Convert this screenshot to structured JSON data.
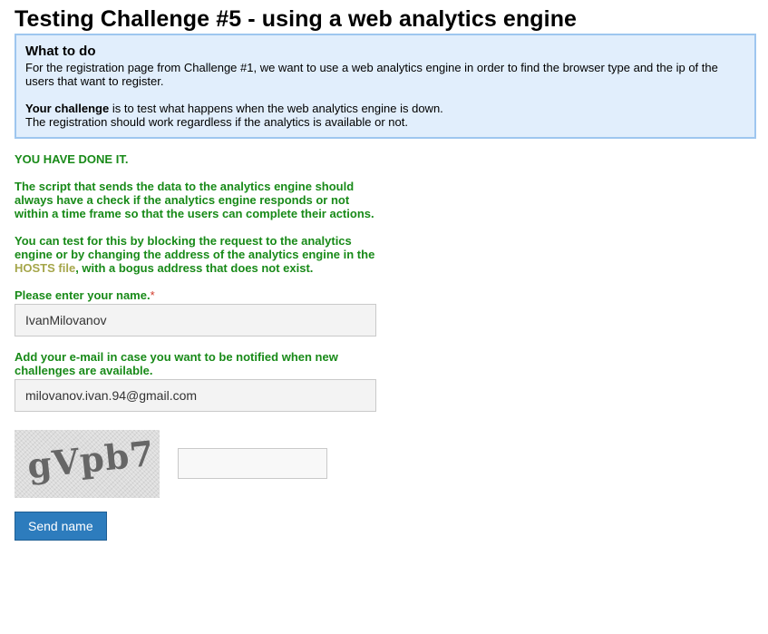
{
  "page": {
    "title": "Testing Challenge #5 - using a web analytics engine"
  },
  "info_box": {
    "heading": "What to do",
    "description": "For the registration page from Challenge #1, we want to use a web analytics engine in order to find the browser type and the ip of the users that want to register.",
    "challenge_label": "Your challenge",
    "challenge_text": " is to test what happens when the web analytics engine is down.",
    "note": "The registration should work regardless if the analytics is available or not."
  },
  "success": {
    "done": "YOU HAVE DONE IT.",
    "explanation": "The script that sends the data to the analytics engine should always have a check if the analytics engine responds or not within a time frame so that the users can complete their actions.",
    "hint_before": "You can test for this by blocking the request to the analytics engine or by changing the address of the analytics engine in the ",
    "hint_link": "HOSTS file",
    "hint_after": ", with a bogus address that does not exist."
  },
  "form": {
    "name_label": "Please enter your name.",
    "required_mark": "*",
    "name_value": "IvanMilovanov",
    "email_label": "Add your e-mail in case you want to be notified when new challenges are available.",
    "email_value": "milovanov.ivan.94@gmail.com",
    "captcha_text": "gVpb7",
    "captcha_value": "",
    "submit_label": "Send name"
  }
}
